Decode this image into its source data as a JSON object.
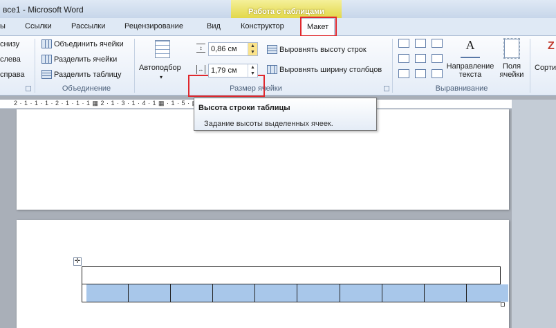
{
  "window": {
    "title": "все1  -  Microsoft Word"
  },
  "context_header": {
    "label": "Работа с таблицами"
  },
  "tabs": [
    {
      "label": "ы"
    },
    {
      "label": "Ссылки"
    },
    {
      "label": "Рассылки"
    },
    {
      "label": "Рецензирование"
    },
    {
      "label": "Вид"
    },
    {
      "label": "Конструктор"
    },
    {
      "label": "Макет",
      "active": true
    }
  ],
  "ribbon": {
    "rows_cols": {
      "insert_below": "снизу",
      "insert_left": "слева",
      "insert_right": "справа"
    },
    "merge": {
      "merge_cells": "Объединить ячейки",
      "split_cells": "Разделить ячейки",
      "split_table": "Разделить таблицу",
      "group_label": "Объединение"
    },
    "cell_size": {
      "autofit": "Автоподбор",
      "row_height": "0,86 см",
      "col_width": "1,79 см",
      "distribute_rows": "Выровнять высоту строк",
      "distribute_cols": "Выровнять ширину столбцов",
      "group_label": "Размер ячейки"
    },
    "alignment": {
      "text_direction": "Направление текста",
      "text_direction_l1": "Направление",
      "text_direction_l2": "текста",
      "cell_margins_l1": "Поля",
      "cell_margins_l2": "ячейки",
      "group_label": "Выравнивание"
    },
    "data": {
      "sort_partial": "Сорти"
    }
  },
  "ruler": {
    "text": "2 · 1 · 1 · 1 · 2 · 1 · 1 · 1 ▦ 2 · 1 · 3 · 1 · 4 · 1 ▦ · 1 · 5 ·                                  ▦ · 1 · 13 · 1 ▦ 15 · 1 ▦ · 1 · 17 · 1"
  },
  "tooltip": {
    "title": "Высота строки таблицы",
    "description": "Задание высоты выделенных ячеек."
  },
  "table": {
    "columns": 10,
    "selected_row": 2
  },
  "colors": {
    "selection": "#a8c7ea",
    "highlight_box": "#e0282d",
    "context_tab": "#e2d84a"
  }
}
